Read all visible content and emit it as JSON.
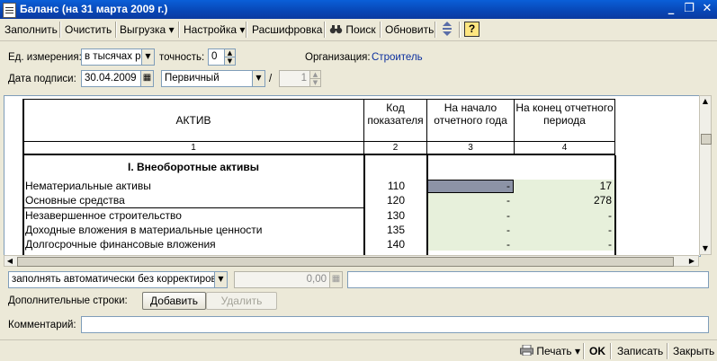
{
  "window": {
    "title": "Баланс (на 31 марта 2009 г.)",
    "minimize": "_",
    "restore": "❐",
    "close": "✕"
  },
  "toolbar": {
    "fill": "Заполнить",
    "clear": "Очистить",
    "export": "Выгрузка ▾",
    "settings": "Настройка ▾",
    "decode": "Расшифровка",
    "search": "Поиск",
    "refresh": "Обновить",
    "help": "?"
  },
  "form": {
    "unit_label": "Ед. измерения:",
    "unit_value": "в тысячах р",
    "precision_label": "точность:",
    "precision_value": "0",
    "org_label": "Организация:",
    "org_value": "Строитель",
    "sign_date_label": "Дата подписи:",
    "sign_date_value": "30.04.2009",
    "type_value": "Первичный",
    "slash": "/",
    "number_value": "1"
  },
  "sheet": {
    "headers": {
      "aktiv": "АКТИВ",
      "code": "Код показателя",
      "start": "На начало отчетного года",
      "end": "На конец отчетного периода"
    },
    "col_numbers": [
      "1",
      "2",
      "3",
      "4"
    ],
    "section_title": "I. Внеоборотные активы",
    "rows": [
      {
        "name": "Нематериальные активы",
        "code": "110",
        "start": "-",
        "end": "17"
      },
      {
        "name": "Основные средства",
        "code": "120",
        "start": "-",
        "end": "278"
      },
      {
        "name": "Незавершенное строительство",
        "code": "130",
        "start": "-",
        "end": "-"
      },
      {
        "name": "Доходные вложения в материальные ценности",
        "code": "135",
        "start": "-",
        "end": "-"
      },
      {
        "name": "Долгосрочные финансовые вложения",
        "code": "140",
        "start": "-",
        "end": "-"
      }
    ]
  },
  "bottom": {
    "mode_value": "заполнять автоматически без корректировки",
    "amount_value": "0,00",
    "extra_rows_label": "Дополнительные строки:",
    "add": "Добавить",
    "delete": "Удалить",
    "comment_label": "Комментарий:",
    "comment_value": ""
  },
  "footer": {
    "print": "Печать ▾",
    "ok": "OK",
    "save": "Записать",
    "close": "Закрыть"
  }
}
